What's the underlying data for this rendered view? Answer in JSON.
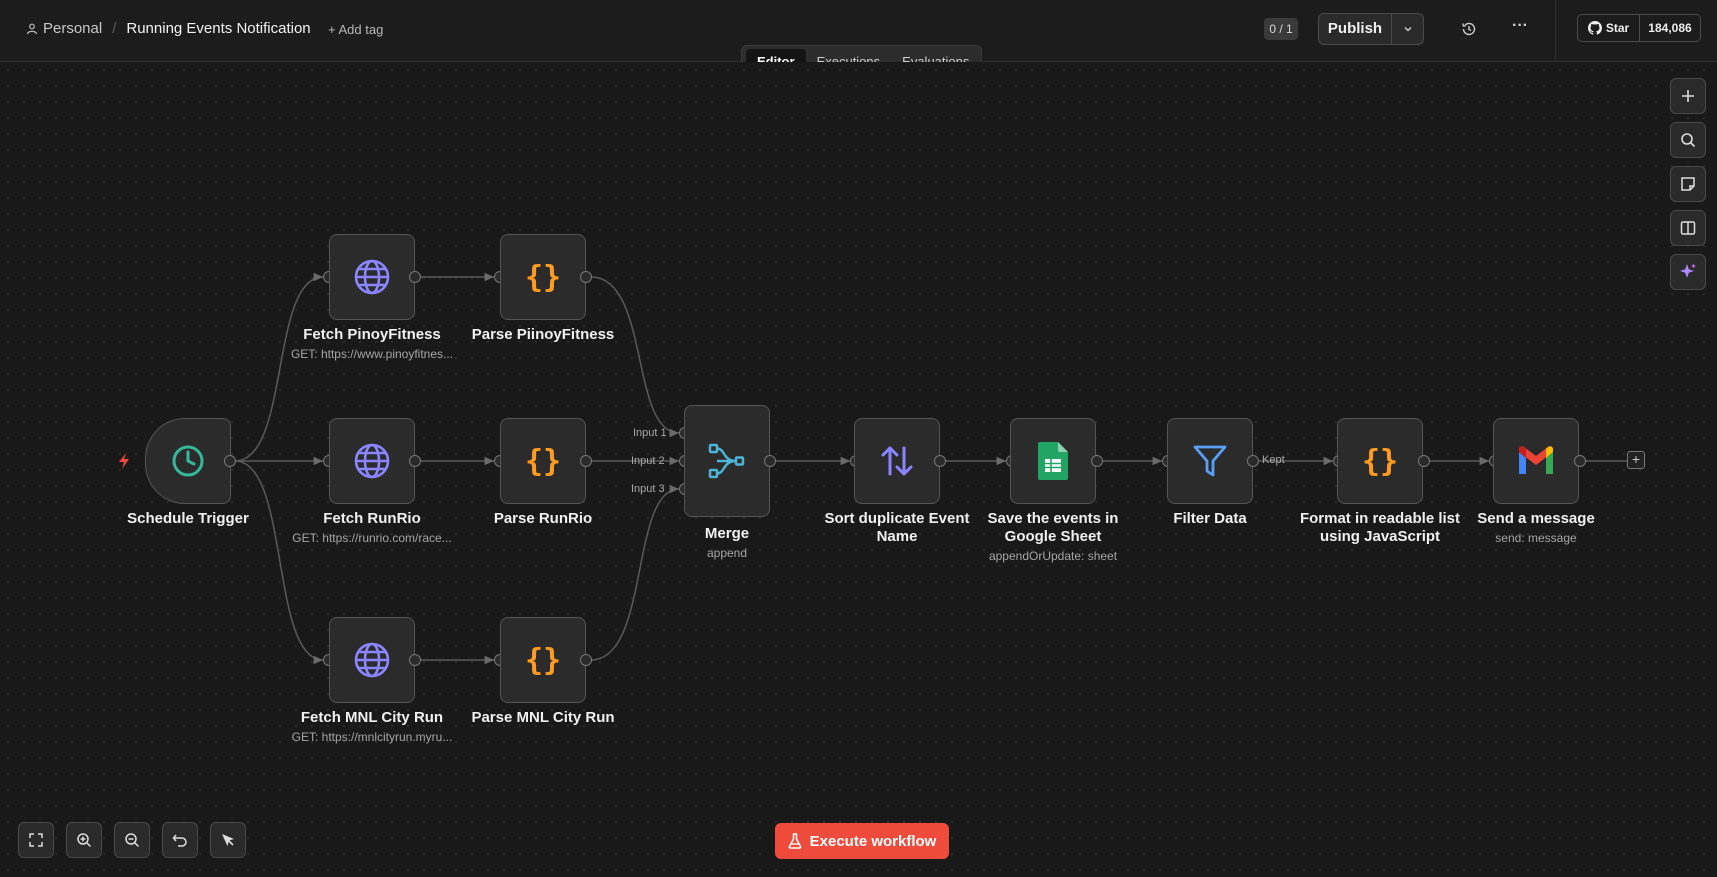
{
  "header": {
    "project": "Personal",
    "separator": "/",
    "workflow_name": "Running Events Notification",
    "add_tag": "+ Add tag",
    "version_badge": "0 / 1",
    "publish_label": "Publish",
    "more_label": "···",
    "github_star_label": "Star",
    "github_star_count": "184,086"
  },
  "tabs": [
    {
      "label": "Editor",
      "active": true
    },
    {
      "label": "Executions",
      "active": false
    },
    {
      "label": "Evaluations",
      "active": false
    }
  ],
  "nodes": {
    "schedule_trigger": {
      "label": "Schedule Trigger",
      "icon": "clock-icon"
    },
    "fetch_pinoy": {
      "label": "Fetch PinoyFitness",
      "sub": "GET: https://www.pinoyfitnes...",
      "icon": "globe-icon"
    },
    "parse_pinoy": {
      "label": "Parse PiinoyFitness",
      "icon": "braces-icon"
    },
    "fetch_runrio": {
      "label": "Fetch RunRio",
      "sub": "GET: https://runrio.com/race...",
      "icon": "globe-icon"
    },
    "parse_runrio": {
      "label": "Parse RunRio",
      "icon": "braces-icon"
    },
    "fetch_mnl": {
      "label": "Fetch MNL City Run",
      "sub": "GET: https://mnlcityrun.myru...",
      "icon": "globe-icon"
    },
    "parse_mnl": {
      "label": "Parse MNL City Run",
      "icon": "braces-icon"
    },
    "merge": {
      "label": "Merge",
      "sub": "append",
      "icon": "merge-icon",
      "inputs": [
        "Input 1",
        "Input 2",
        "Input 3"
      ]
    },
    "sort": {
      "label": "Sort duplicate Event Name",
      "icon": "sort-arrows-icon"
    },
    "sheets": {
      "label": "Save the events in Google Sheet",
      "sub": "appendOrUpdate: sheet",
      "icon": "google-sheets-icon"
    },
    "filter": {
      "label": "Filter Data",
      "icon": "filter-icon",
      "branch_label": "Kept"
    },
    "format": {
      "label": "Format in readable list using JavaScript",
      "icon": "braces-icon"
    },
    "gmail": {
      "label": "Send a message",
      "sub": "send: message",
      "icon": "gmail-icon"
    }
  },
  "execute_button": "Execute workflow",
  "colors": {
    "accent": "#ef4b3d",
    "globe": "#8b85ff",
    "code": "#ff9b21",
    "clock": "#34b89a",
    "merge": "#4db4d8",
    "filter": "#57a0f5",
    "sheets": "#21a464"
  }
}
